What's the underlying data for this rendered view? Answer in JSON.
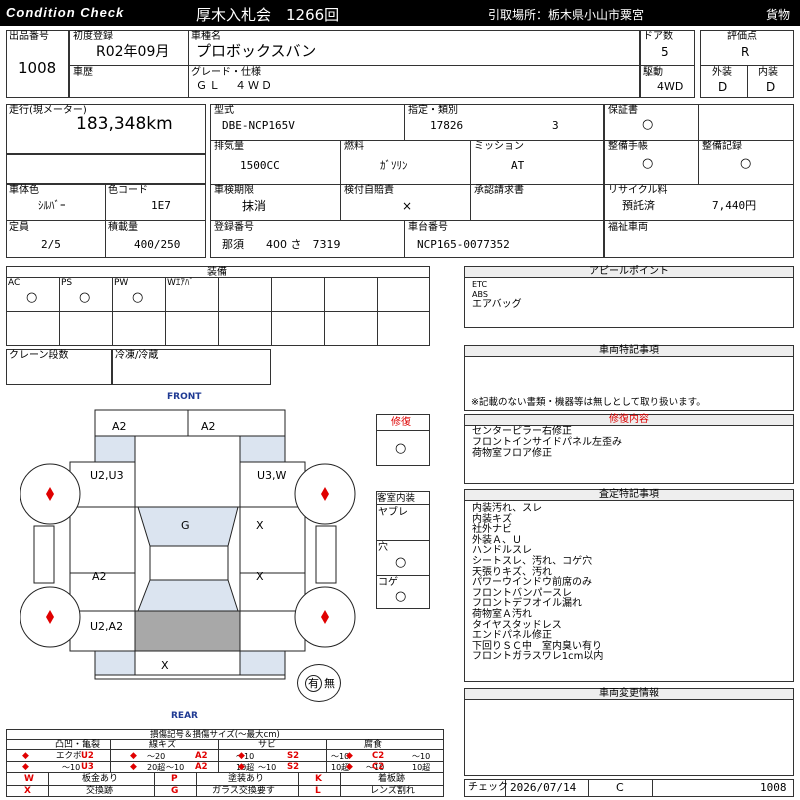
{
  "header": {
    "condition_check": "Condition Check",
    "auction_title": "厚木入札会　1266回",
    "pickup_location": "引取場所：栃木県小山市粟宮",
    "vehicle_class": "貨物"
  },
  "row1": {
    "lot_label": "出品番号",
    "lot_value": "1008",
    "first_reg_label": "初度登録",
    "first_reg_value": "R02年09月",
    "car_name_label": "車種名",
    "car_name_value": "プロボックスバン",
    "doors_label": "ドア数",
    "doors_value": "5",
    "score_label": "評価点",
    "score_value": "R",
    "history_label": "車歴",
    "grade_label": "グレード・仕様",
    "grade_value": "ＧＬ　４ＷＤ",
    "drive_label": "駆動",
    "drive_value": "4WD",
    "exterior_label": "外装",
    "exterior_value": "D",
    "interior_label": "内装",
    "interior_value": "D"
  },
  "specs": {
    "mileage_label": "走行(現メーター)",
    "mileage_value": "183,348km",
    "model_label": "型式",
    "model_value": "DBE-NCP165V",
    "designation_label": "指定・類別",
    "designation_value": "17826",
    "category_value": "3",
    "warranty_label": "保証書",
    "warranty_mark": "○",
    "displacement_label": "排気量",
    "displacement_value": "1500CC",
    "fuel_label": "燃料",
    "fuel_value": "ｶﾞｿﾘﾝ",
    "transmission_label": "ミッション",
    "transmission_value": "AT",
    "service_book_label": "整備手帳",
    "service_book_mark": "○",
    "service_record_label": "整備記録",
    "service_record_mark": "○",
    "color_label": "車体色",
    "color_value": "ｼﾙﾊﾞｰ",
    "color_code_label": "色コード",
    "color_code_value": "1E7",
    "inspection_label": "車検期限",
    "inspection_value": "抹消",
    "tax_label": "検付自賠責",
    "tax_value": "×",
    "approval_label": "承認請求書",
    "recycle_label": "リサイクル料",
    "recycle_status": "預託済",
    "recycle_amount": "7,440円",
    "capacity_label": "定員",
    "capacity_value": "2/5",
    "load_label": "積載量",
    "load_value": "400/250",
    "reg_no_label": "登録番号",
    "reg_no_value": "那須　　400 さ　7319",
    "chassis_label": "車台番号",
    "chassis_value": "NCP165-0077352",
    "welfare_label": "福祉車両"
  },
  "equipment": {
    "title": "装備",
    "row1": [
      {
        "label": "AC",
        "mark": "○"
      },
      {
        "label": "PS",
        "mark": "○"
      },
      {
        "label": "PW",
        "mark": "○"
      },
      {
        "label": "Wｴｱﾊﾞ",
        "mark": ""
      },
      {
        "label": "",
        "mark": ""
      },
      {
        "label": "",
        "mark": ""
      },
      {
        "label": "",
        "mark": ""
      },
      {
        "label": "",
        "mark": ""
      }
    ],
    "crane_label": "クレーン段数",
    "refrig_label": "冷凍/冷蔵"
  },
  "appeal": {
    "title": "アピールポイント",
    "lines": [
      "ETC",
      "ABS",
      "エアバッグ"
    ]
  },
  "special": {
    "title": "車両特記事項",
    "disclaimer": "※記載のない書類・機器等は無しとして取り扱います。"
  },
  "repair": {
    "title": "修復内容",
    "lines": [
      "センターピラー右修正",
      "フロントインサイドパネル左歪み",
      "荷物室フロア修正"
    ]
  },
  "inspector": {
    "title": "査定特記事項",
    "lines": [
      "内装汚れ、スレ",
      "内装キズ",
      "社外ナビ",
      "外装Ａ、Ｕ",
      "ハンドルスレ",
      "シートスレ、汚れ、コゲ穴",
      "天張りキズ、汚れ",
      "パワーウインドウ前席のみ",
      "フロントバンパースレ",
      "フロントデフオイル漏れ",
      "荷物室Ａ汚れ",
      "タイヤスタッドレス",
      "エンドパネル修正",
      "下回りＳＣ中　室内臭い有り",
      "フロントガラスワレ1cm以内"
    ]
  },
  "changes": {
    "title": "車両変更情報"
  },
  "check": {
    "label": "チェック",
    "date": "2026/07/14",
    "code": "C",
    "number": "1008"
  },
  "diagram": {
    "front_label": "FRONT",
    "rear_label": "REAR",
    "marks": {
      "front_left": "A2",
      "front_right": "A2",
      "fender_left": "U2,U3",
      "fender_right": "U3,W",
      "hood": "G",
      "door_front_right": "X",
      "door_rear_left": "A2",
      "door_rear_right": "X",
      "quarter_left": "U2,A2",
      "rear_bumper": "X"
    },
    "repair_box_label": "修復",
    "repair_box_mark": "○",
    "cabin_label": "客室内装",
    "cabin_items": [
      {
        "label": "ヤブレ",
        "mark": ""
      },
      {
        "label": "穴",
        "mark": "○"
      },
      {
        "label": "コゲ",
        "mark": "○"
      }
    ],
    "ari_nashi": "有",
    "ari_nashi_none": "無"
  },
  "legend": {
    "title": "損傷記号＆損傷サイズ(～最大cm)",
    "groups": [
      {
        "title": "凸凹・亀裂",
        "code1": "エクボ",
        "code2": "U2",
        "size2a": "～20",
        "size1b": "～10",
        "code2b": "U3",
        "size2b": "20超"
      },
      {
        "title": "線キズ",
        "code1": "A2",
        "size1": "～10",
        "size1b": "～10",
        "code2b": "A2",
        "size2b": "10超"
      },
      {
        "title": "サビ",
        "code1": "S2",
        "size1": "～10",
        "size1b": "～10",
        "code2b": "S2",
        "size2b": "10超"
      },
      {
        "title": "腐食",
        "code1": "C2",
        "size1": "～10",
        "size1b": "～10",
        "code2b": "C2",
        "size2b": "10超"
      }
    ],
    "codes": [
      {
        "code": "W",
        "desc": "板金あり"
      },
      {
        "code": "P",
        "desc": "塗装あり"
      },
      {
        "code": "K",
        "desc": "着板跡"
      },
      {
        "code": "X",
        "desc": "交換跡"
      },
      {
        "code": "G",
        "desc": "ガラス交換要す"
      },
      {
        "code": "L",
        "desc": "レンズ割れ"
      }
    ]
  },
  "colors": {
    "header_bg": "#000000",
    "red_mark": "#e00000",
    "front_rear_text": "#1f3a93",
    "panel_blue": "#dbe4f0",
    "panel_gray": "#a8a8a8"
  }
}
